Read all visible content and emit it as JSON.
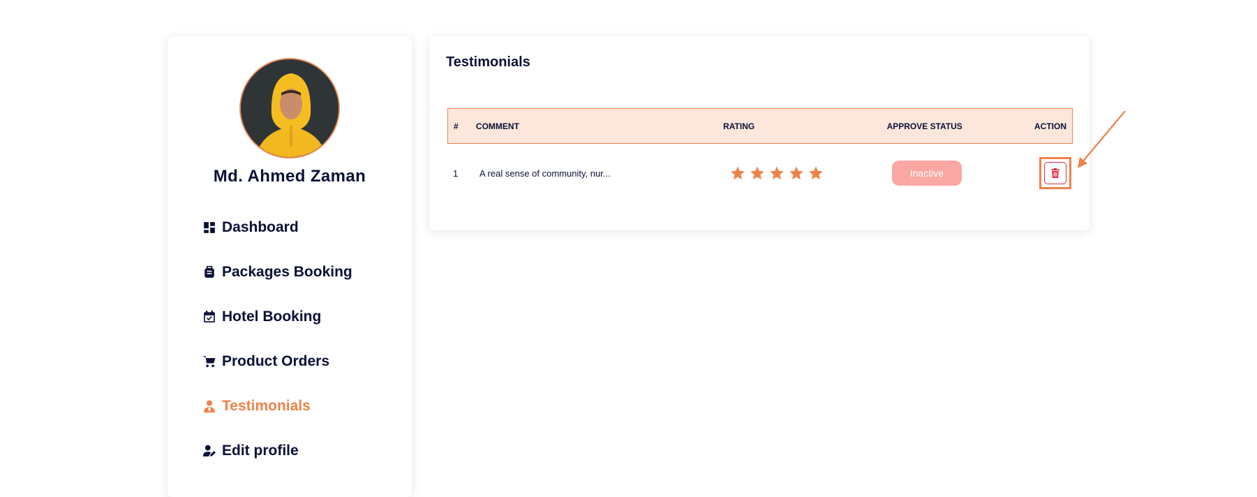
{
  "profile": {
    "name": "Md. Ahmed Zaman"
  },
  "nav": {
    "items": [
      {
        "label": "Dashboard",
        "icon": "dashboard-icon"
      },
      {
        "label": "Packages Booking",
        "icon": "luggage-icon"
      },
      {
        "label": "Hotel Booking",
        "icon": "calendar-check-icon"
      },
      {
        "label": "Product Orders",
        "icon": "cart-icon"
      },
      {
        "label": "Testimonials",
        "icon": "user-tie-icon",
        "active": true
      },
      {
        "label": "Edit profile",
        "icon": "user-edit-icon"
      }
    ]
  },
  "testimonials": {
    "title": "Testimonials",
    "columns": [
      "#",
      "COMMENT",
      "RATING",
      "APPROVE STATUS",
      "ACTION"
    ],
    "rows": [
      {
        "num": "1",
        "comment": "A real sense of community, nur...",
        "rating": 5,
        "status": "Inactive"
      }
    ]
  },
  "colors": {
    "accent": "#ef8249",
    "text": "#0b1036",
    "header_bg": "#fde6dc",
    "status_inactive": "#fba7a4",
    "delete": "#e2273f"
  }
}
